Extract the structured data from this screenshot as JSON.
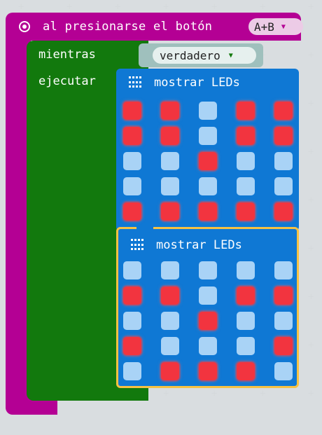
{
  "event": {
    "label": "al presionarse el botón",
    "button_value": "A+B",
    "color": "#b40094"
  },
  "loop": {
    "while_label": "mientras",
    "do_label": "ejecutar",
    "condition_value": "verdadero",
    "color": "#12790d"
  },
  "show_leds_blocks": [
    {
      "title": "mostrar LEDs",
      "selected": false,
      "leds": [
        [
          1,
          1,
          0,
          1,
          1
        ],
        [
          1,
          1,
          0,
          1,
          1
        ],
        [
          0,
          0,
          1,
          0,
          0
        ],
        [
          0,
          0,
          0,
          0,
          0
        ],
        [
          1,
          1,
          1,
          1,
          1
        ]
      ]
    },
    {
      "title": "mostrar LEDs",
      "selected": true,
      "leds": [
        [
          0,
          0,
          0,
          0,
          0
        ],
        [
          1,
          1,
          0,
          1,
          1
        ],
        [
          0,
          0,
          1,
          0,
          0
        ],
        [
          1,
          0,
          0,
          0,
          1
        ],
        [
          0,
          1,
          1,
          1,
          0
        ]
      ]
    }
  ],
  "colors": {
    "led_on": "#f2343f",
    "led_off": "#a9d3f6",
    "block_blue": "#0f78d4",
    "selection": "#f6c243",
    "workspace": "#eceff1"
  }
}
